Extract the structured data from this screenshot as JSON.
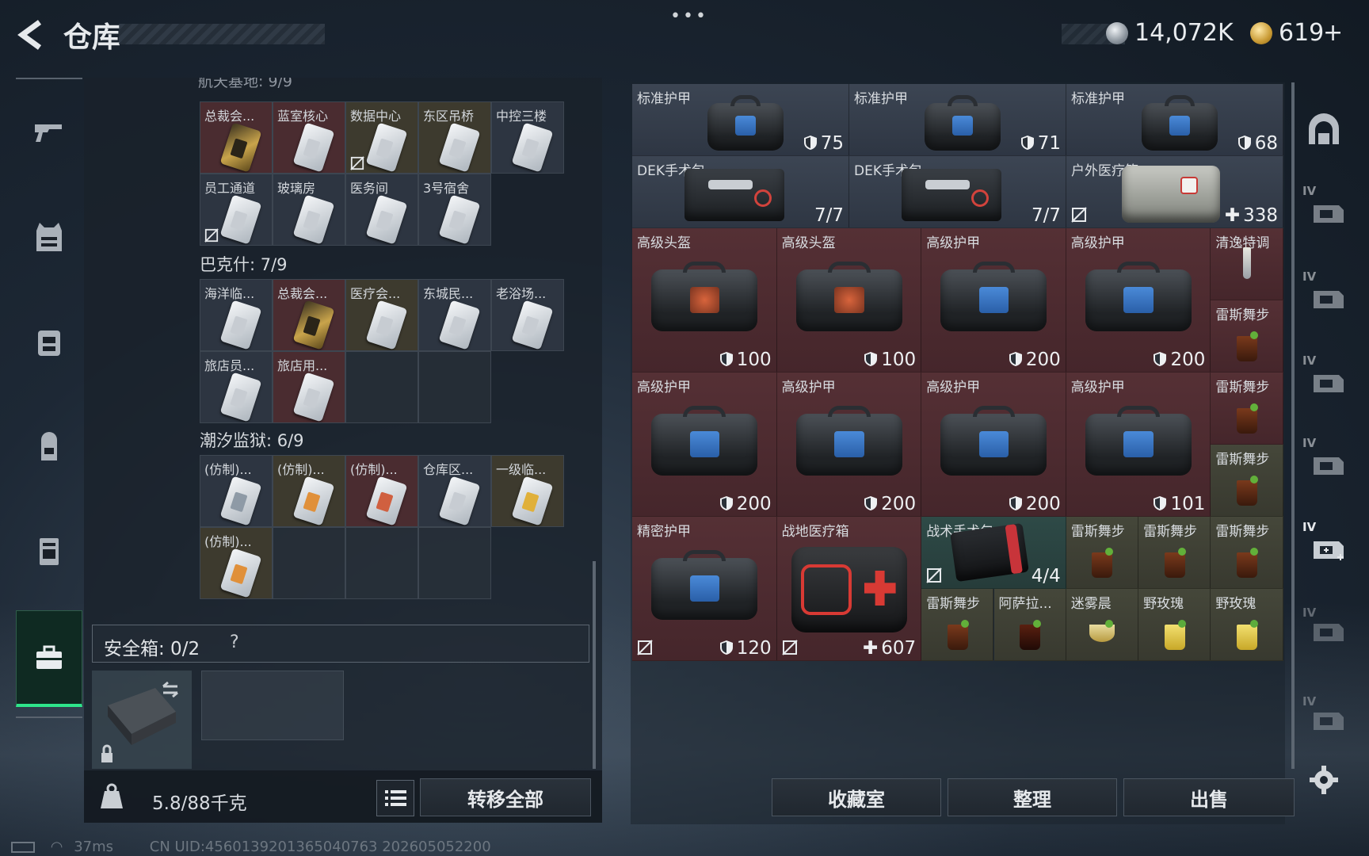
{
  "header": {
    "title": "仓库",
    "currency_silver": "14,072K",
    "currency_gold": "619",
    "plus": "+"
  },
  "left_groups": [
    {
      "title": "航天基地: 9/9",
      "cells": [
        "总裁会...",
        "蓝室核心",
        "数据中心",
        "东区吊桥",
        "中控三楼",
        "员工通道",
        "玻璃房",
        "医务间",
        "3号宿舍"
      ]
    },
    {
      "title": "巴克什: 7/9",
      "cells": [
        "海洋临...",
        "总裁会...",
        "医疗会...",
        "东城民...",
        "老浴场...",
        "旅店员...",
        "旅店用..."
      ]
    },
    {
      "title": "潮汐监狱: 6/9",
      "cells": [
        "(仿制)...",
        "(仿制)...",
        "(仿制)...",
        "仓库区...",
        "一级临...",
        "(仿制)..."
      ]
    }
  ],
  "safe": {
    "label": "安全箱: 0/2",
    "help": "?"
  },
  "footer": {
    "weight": "5.8/88千克",
    "transfer_all": "转移全部"
  },
  "grid": [
    {
      "label": "标准护甲",
      "value": "75"
    },
    {
      "label": "标准护甲",
      "value": "71"
    },
    {
      "label": "标准护甲",
      "value": "68"
    },
    {
      "label": "DEK手术包",
      "value": "7/7"
    },
    {
      "label": "DEK手术包",
      "value": "7/7"
    },
    {
      "label": "户外医疗箱",
      "value": "338"
    },
    {
      "label": "高级头盔",
      "value": "100"
    },
    {
      "label": "高级头盔",
      "value": "100"
    },
    {
      "label": "高级护甲",
      "value": "200"
    },
    {
      "label": "高级护甲",
      "value": "200"
    },
    {
      "label": "清逸特调",
      "value": ""
    },
    {
      "label": "雷斯舞步",
      "value": ""
    },
    {
      "label": "高级护甲",
      "value": "200"
    },
    {
      "label": "高级护甲",
      "value": "200"
    },
    {
      "label": "高级护甲",
      "value": "200"
    },
    {
      "label": "高级护甲",
      "value": "101"
    },
    {
      "label": "雷斯舞步",
      "value": ""
    },
    {
      "label": "雷斯舞步",
      "value": ""
    },
    {
      "label": "精密护甲",
      "value": "120"
    },
    {
      "label": "战地医疗箱",
      "value": "607"
    },
    {
      "label": "战术手术包",
      "value": "4/4"
    },
    {
      "label": "雷斯舞步",
      "value": ""
    },
    {
      "label": "雷斯舞步",
      "value": ""
    },
    {
      "label": "雷斯舞步",
      "value": ""
    },
    {
      "label": "雷斯舞步",
      "value": ""
    },
    {
      "label": "阿萨拉...",
      "value": ""
    },
    {
      "label": "迷雾晨",
      "value": ""
    },
    {
      "label": "野玫瑰",
      "value": ""
    },
    {
      "label": "野玫瑰",
      "value": ""
    }
  ],
  "bottom_buttons": {
    "collection": "收藏室",
    "organize": "整理",
    "sell": "出售"
  },
  "rail": {
    "tier_label": "IV"
  },
  "status": {
    "ping": "37ms",
    "uid": "CN UID:4560139201365040763 202605052200"
  }
}
